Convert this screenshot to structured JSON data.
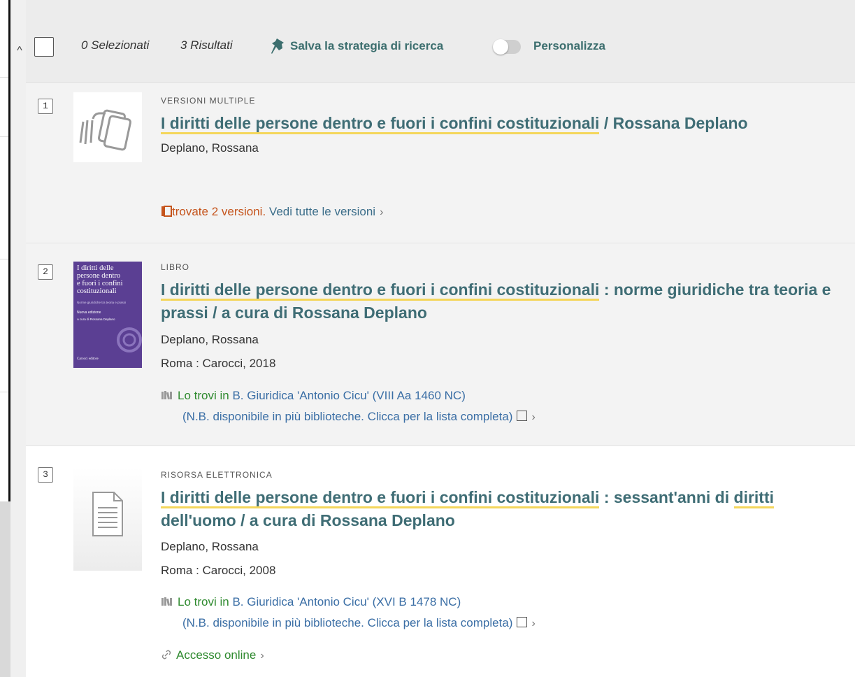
{
  "toolbar": {
    "selected": "0 Selezionati",
    "results": "3 Risultati",
    "save_search": "Salva la strategia di ricerca",
    "personalize": "Personalizza",
    "personalize_on": false
  },
  "results": [
    {
      "number": "1",
      "type": "VERSIONI MULTIPLE",
      "title_highlight": "I diritti delle persone dentro e fuori i confini costituzionali",
      "title_rest": " / Rossana Deplano",
      "author": "Deplano, Rossana",
      "versions_found": "trovate 2 versioni.",
      "versions_link": "Vedi tutte le versioni",
      "thumb_icon": "multiple-versions-icon"
    },
    {
      "number": "2",
      "type": "LIBRO",
      "title_highlight": "I diritti delle persone dentro e fuori i confini costituzionali",
      "title_rest": " : norme giuridiche tra teoria e prassi / a cura di Rossana Deplano",
      "author": "Deplano, Rossana",
      "publication": "Roma : Carocci, 2018",
      "avail_prefix": "Lo trovi in",
      "avail_location": "B. Giuridica 'Antonio Cicu'  (VIII Aa 1460 NC)",
      "avail_note": "(N.B. disponibile in più biblioteche. Clicca per la lista completa)",
      "cover": {
        "title": "I diritti delle persone dentro e fuori i confini costituzionali",
        "subtitle": "Norme giuridiche tra teoria e prassi",
        "edition": "Nuova edizione",
        "editor": "A cura di Rossana Deplano",
        "publisher": "Carocci editore",
        "color": "#5b3f93"
      }
    },
    {
      "number": "3",
      "type": "RISORSA ELETTRONICA",
      "title_highlight": "I diritti delle persone dentro e fuori i confini costituzionali",
      "title_mid": " : sessant'anni di ",
      "title_highlight2": "diritti",
      "title_rest": " dell'uomo / a cura di Rossana Deplano",
      "author": "Deplano, Rossana",
      "publication": "Roma : Carocci, 2008",
      "avail_prefix": "Lo trovi in",
      "avail_location": "B. Giuridica 'Antonio Cicu'  (XVI B 1478 NC)",
      "avail_note": "(N.B. disponibile in più biblioteche. Clicca per la lista completa)",
      "online": "Accesso online",
      "thumb_icon": "document-icon"
    }
  ],
  "colors": {
    "title": "#3f6d75",
    "highlight": "#f4d65b",
    "available": "#2f8a2f",
    "versions": "#c5541c"
  }
}
